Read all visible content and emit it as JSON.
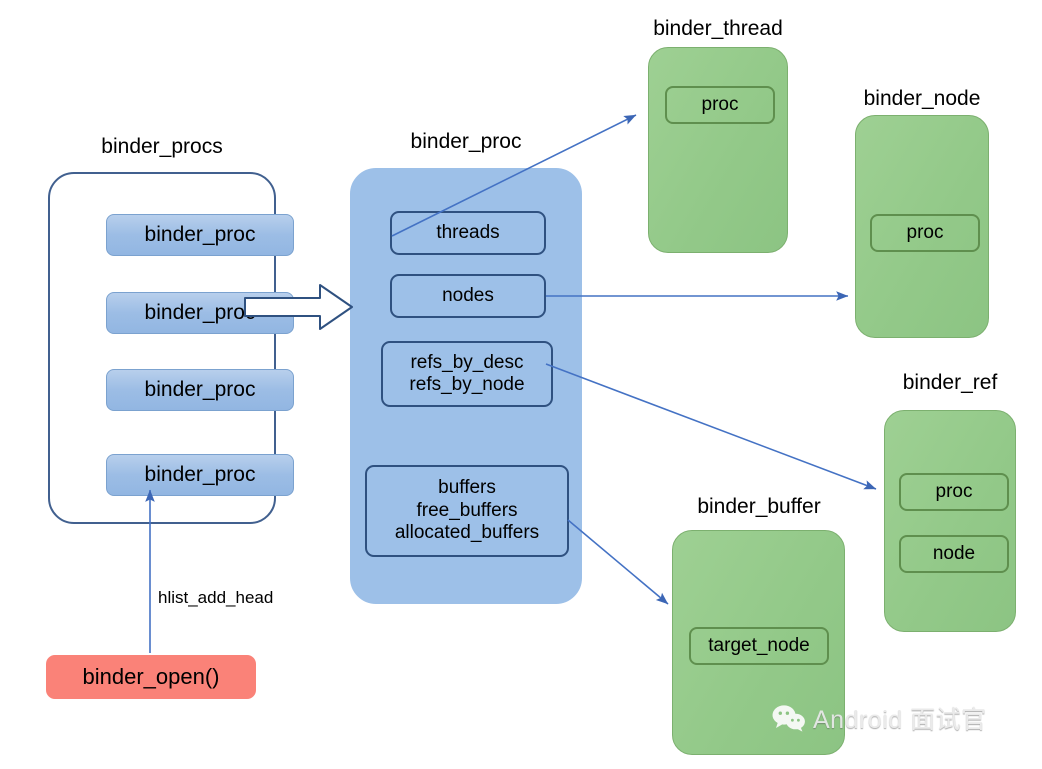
{
  "diagram": {
    "title_binder_procs": "binder_procs",
    "title_binder_proc": "binder_proc",
    "title_binder_thread": "binder_thread",
    "title_binder_node": "binder_node",
    "title_binder_ref": "binder_ref",
    "title_binder_buffer": "binder_buffer"
  },
  "binder_procs": {
    "label": "binder_procs",
    "items": [
      {
        "label": "binder_proc"
      },
      {
        "label": "binder_proc"
      },
      {
        "label": "binder_proc"
      },
      {
        "label": "binder_proc"
      }
    ]
  },
  "binder_proc": {
    "label": "binder_proc",
    "fields": [
      {
        "name": "threads",
        "lines": [
          "threads"
        ]
      },
      {
        "name": "nodes",
        "lines": [
          "nodes"
        ]
      },
      {
        "name": "refs",
        "lines": [
          "refs_by_desc",
          "refs_by_node"
        ]
      },
      {
        "name": "buffers",
        "lines": [
          "buffers",
          "free_buffers",
          "allocated_buffers"
        ]
      }
    ]
  },
  "binder_thread": {
    "label": "binder_thread",
    "fields": [
      {
        "label": "proc"
      }
    ]
  },
  "binder_node": {
    "label": "binder_node",
    "fields": [
      {
        "label": "proc"
      }
    ]
  },
  "binder_ref": {
    "label": "binder_ref",
    "fields": [
      {
        "label": "proc"
      },
      {
        "label": "node"
      }
    ]
  },
  "binder_buffer": {
    "label": "binder_buffer",
    "fields": [
      {
        "label": "target_node"
      }
    ]
  },
  "entry": {
    "function_label": "binder_open()",
    "edge_label": "hlist_add_head"
  },
  "watermark": {
    "text": "Android 面试官",
    "icon": "wechat-icon"
  },
  "colors": {
    "blue_fill": "#9dc0e8",
    "blue_item_fill": "#a8c6e8",
    "blue_stroke": "#2f5180",
    "container_stroke": "#41608f",
    "green_fill": "#93c989",
    "green_stroke": "#5f8f4e",
    "red_fill": "#fa8278",
    "arrow_color": "#4472c4",
    "text_color": "#000000"
  }
}
